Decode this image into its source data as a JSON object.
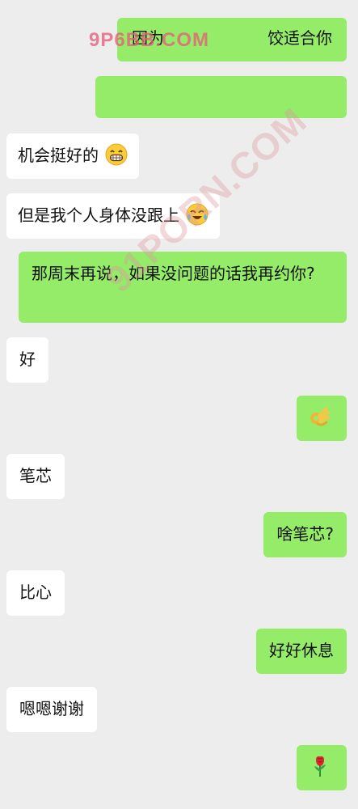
{
  "messages": [
    {
      "side": "right",
      "text": "因为",
      "text2": "饺适合你"
    },
    {
      "side": "right",
      "text": ""
    },
    {
      "side": "left",
      "text": "机会挺好的",
      "emoji": "grinning-face-emoji"
    },
    {
      "side": "left",
      "text": "但是我个人身体没跟上",
      "emoji": "crying-laughing-emoji"
    },
    {
      "side": "right",
      "text": "那周末再说，如果没问题的话我再约你?"
    },
    {
      "side": "left",
      "text": "好"
    },
    {
      "side": "right",
      "text": "",
      "emoji": "ok-hand-emoji"
    },
    {
      "side": "left",
      "text": "笔芯"
    },
    {
      "side": "right",
      "text": "啥笔芯?"
    },
    {
      "side": "left",
      "text": "比心"
    },
    {
      "side": "right",
      "text": "好好休息"
    },
    {
      "side": "left",
      "text": "嗯嗯谢谢"
    },
    {
      "side": "right",
      "text": "",
      "emoji": "rose-emoji"
    }
  ],
  "watermarks": {
    "top": "9P6BB.COM",
    "diagonal": "91PORN.COM"
  },
  "colors": {
    "background": "#ededed",
    "bubble_left": "#ffffff",
    "bubble_right": "#95ec69",
    "text": "#111111"
  }
}
